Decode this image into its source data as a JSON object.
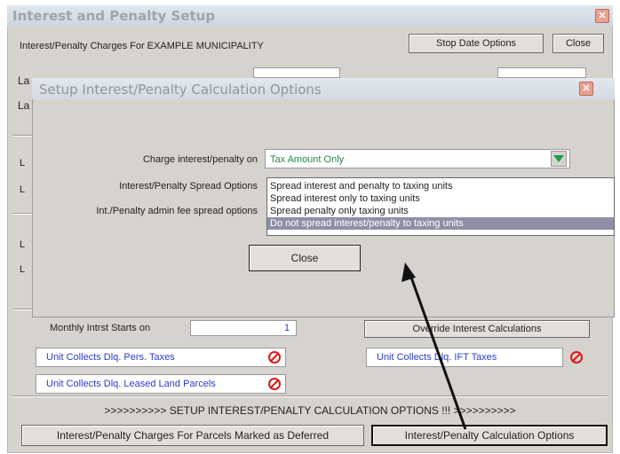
{
  "window": {
    "title": "Interest and Penalty Setup",
    "subtitle": "Interest/Penalty Charges For EXAMPLE MUNICIPALITY",
    "stop_date_options_label": "Stop Date Options",
    "close_label": "Close",
    "partial_labels": [
      "La",
      "La",
      "L",
      "L",
      "L",
      "L"
    ]
  },
  "dialog": {
    "title": "Setup Interest/Penalty Calculation Options",
    "charge_label": "Charge interest/penalty on",
    "charge_value": "Tax Amount Only",
    "spread_label": "Interest/Penalty Spread Options",
    "admin_fee_label": "Int./Penalty admin fee spread options",
    "spread_options": [
      "Spread interest and penalty to taxing units",
      "Spread interest only to taxing units",
      "Spread penalty only taxing units",
      "Do not spread interest/penalty to taxing units"
    ],
    "selected_index": 3,
    "close_label": "Close"
  },
  "lower": {
    "monthly_label": "Monthly Intrst Starts on",
    "monthly_value": "1",
    "override_label": "Override Interest Calculations",
    "pers_taxes_label": "Unit Collects Dlq. Pers. Taxes",
    "ift_taxes_label": "Unit Collects Dlq. IFT Taxes",
    "leased_land_label": "Unit Collects Dlq. Leased Land Parcels",
    "banner": ">>>>>>>>>> SETUP INTEREST/PENALTY CALCULATION OPTIONS !!! >>>>>>>>>>",
    "deferred_button": "Interest/Penalty Charges For Parcels Marked as Deferred",
    "calc_options_button": "Interest/Penalty Calculation Options"
  },
  "colors": {
    "title_text": "#9ea6ad",
    "link_blue": "#2a3bd0",
    "value_green": "#1f8a4a",
    "selected_row": "#8f8fa8",
    "no_symbol_red": "#e01818"
  }
}
